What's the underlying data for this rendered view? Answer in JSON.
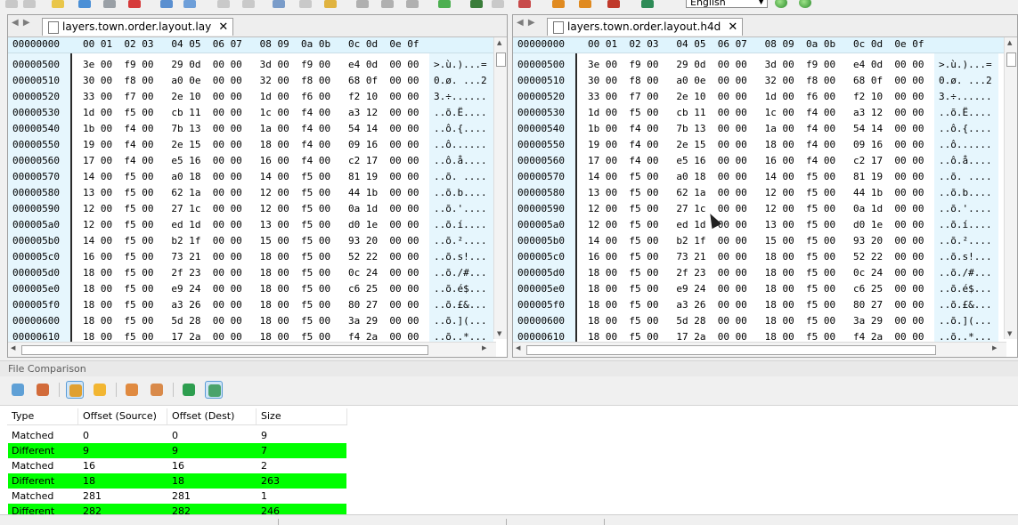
{
  "toolbar": {
    "language": "English"
  },
  "colors": {
    "offset_bg": "#e6f6fd",
    "diff_row": "#00ff00",
    "selected": "#cfe5f7"
  },
  "hex_header": {
    "offset_label": "00000000",
    "cols": "00 01  02 03   04 05  06 07   08 09  0a 0b   0c 0d  0e 0f"
  },
  "left_pane": {
    "tab_title": "layers.town.order.layout.lay",
    "rows": [
      {
        "offset": "00000500",
        "hex": "3e 00  f9 00   29 0d  00 00   3d 00  f9 00   e4 0d  00 00",
        "ascii": ">.ù.)...="
      },
      {
        "offset": "00000510",
        "hex": "30 00  f8 00   a0 0e  00 00   32 00  f8 00   68 0f  00 00",
        "ascii": "0.ø. ...2"
      },
      {
        "offset": "00000520",
        "hex": "33 00  f7 00   2e 10  00 00   1d 00  f6 00   f2 10  00 00",
        "ascii": "3.÷......"
      },
      {
        "offset": "00000530",
        "hex": "1d 00  f5 00   cb 11  00 00   1c 00  f4 00   a3 12  00 00",
        "ascii": "..õ.Ë...."
      },
      {
        "offset": "00000540",
        "hex": "1b 00  f4 00   7b 13  00 00   1a 00  f4 00   54 14  00 00",
        "ascii": "..ô.{...."
      },
      {
        "offset": "00000550",
        "hex": "19 00  f4 00   2e 15  00 00   18 00  f4 00   09 16  00 00",
        "ascii": "..ô......"
      },
      {
        "offset": "00000560",
        "hex": "17 00  f4 00   e5 16  00 00   16 00  f4 00   c2 17  00 00",
        "ascii": "..ô.å...."
      },
      {
        "offset": "00000570",
        "hex": "14 00  f5 00   a0 18  00 00   14 00  f5 00   81 19  00 00",
        "ascii": "..õ. ...."
      },
      {
        "offset": "00000580",
        "hex": "13 00  f5 00   62 1a  00 00   12 00  f5 00   44 1b  00 00",
        "ascii": "..õ.b...."
      },
      {
        "offset": "00000590",
        "hex": "12 00  f5 00   27 1c  00 00   12 00  f5 00   0a 1d  00 00",
        "ascii": "..õ.'...."
      },
      {
        "offset": "000005a0",
        "hex": "12 00  f5 00   ed 1d  00 00   13 00  f5 00   d0 1e  00 00",
        "ascii": "..õ.í...."
      },
      {
        "offset": "000005b0",
        "hex": "14 00  f5 00   b2 1f  00 00   15 00  f5 00   93 20  00 00",
        "ascii": "..õ.².... "
      },
      {
        "offset": "000005c0",
        "hex": "16 00  f5 00   73 21  00 00   18 00  f5 00   52 22  00 00",
        "ascii": "..õ.s!..."
      },
      {
        "offset": "000005d0",
        "hex": "18 00  f5 00   2f 23  00 00   18 00  f5 00   0c 24  00 00",
        "ascii": "..õ./#..."
      },
      {
        "offset": "000005e0",
        "hex": "18 00  f5 00   e9 24  00 00   18 00  f5 00   c6 25  00 00",
        "ascii": "..õ.é$..."
      },
      {
        "offset": "000005f0",
        "hex": "18 00  f5 00   a3 26  00 00   18 00  f5 00   80 27  00 00",
        "ascii": "..õ.£&..."
      },
      {
        "offset": "00000600",
        "hex": "18 00  f5 00   5d 28  00 00   18 00  f5 00   3a 29  00 00",
        "ascii": "..õ.](..."
      },
      {
        "offset": "00000610",
        "hex": "18 00  f5 00   17 2a  00 00   18 00  f5 00   f4 2a  00 00",
        "ascii": "..õ..*..."
      }
    ]
  },
  "right_pane": {
    "tab_title": "layers.town.order.layout.h4d",
    "rows": [
      {
        "offset": "00000500",
        "hex": "3e 00  f9 00   29 0d  00 00   3d 00  f9 00   e4 0d  00 00",
        "ascii": ">.ù.)...="
      },
      {
        "offset": "00000510",
        "hex": "30 00  f8 00   a0 0e  00 00   32 00  f8 00   68 0f  00 00",
        "ascii": "0.ø. ...2"
      },
      {
        "offset": "00000520",
        "hex": "33 00  f7 00   2e 10  00 00   1d 00  f6 00   f2 10  00 00",
        "ascii": "3.÷......"
      },
      {
        "offset": "00000530",
        "hex": "1d 00  f5 00   cb 11  00 00   1c 00  f4 00   a3 12  00 00",
        "ascii": "..õ.Ë...."
      },
      {
        "offset": "00000540",
        "hex": "1b 00  f4 00   7b 13  00 00   1a 00  f4 00   54 14  00 00",
        "ascii": "..ô.{...."
      },
      {
        "offset": "00000550",
        "hex": "19 00  f4 00   2e 15  00 00   18 00  f4 00   09 16  00 00",
        "ascii": "..ô......"
      },
      {
        "offset": "00000560",
        "hex": "17 00  f4 00   e5 16  00 00   16 00  f4 00   c2 17  00 00",
        "ascii": "..ô.å...."
      },
      {
        "offset": "00000570",
        "hex": "14 00  f5 00   a0 18  00 00   14 00  f5 00   81 19  00 00",
        "ascii": "..õ. ...."
      },
      {
        "offset": "00000580",
        "hex": "13 00  f5 00   62 1a  00 00   12 00  f5 00   44 1b  00 00",
        "ascii": "..õ.b...."
      },
      {
        "offset": "00000590",
        "hex": "12 00  f5 00   27 1c  00 00   12 00  f5 00   0a 1d  00 00",
        "ascii": "..õ.'...."
      },
      {
        "offset": "000005a0",
        "hex": "12 00  f5 00   ed 1d  00 00   13 00  f5 00   d0 1e  00 00",
        "ascii": "..õ.í...."
      },
      {
        "offset": "000005b0",
        "hex": "14 00  f5 00   b2 1f  00 00   15 00  f5 00   93 20  00 00",
        "ascii": "..õ.².... "
      },
      {
        "offset": "000005c0",
        "hex": "16 00  f5 00   73 21  00 00   18 00  f5 00   52 22  00 00",
        "ascii": "..õ.s!..."
      },
      {
        "offset": "000005d0",
        "hex": "18 00  f5 00   2f 23  00 00   18 00  f5 00   0c 24  00 00",
        "ascii": "..õ./#..."
      },
      {
        "offset": "000005e0",
        "hex": "18 00  f5 00   e9 24  00 00   18 00  f5 00   c6 25  00 00",
        "ascii": "..õ.é$..."
      },
      {
        "offset": "000005f0",
        "hex": "18 00  f5 00   a3 26  00 00   18 00  f5 00   80 27  00 00",
        "ascii": "..õ.£&..."
      },
      {
        "offset": "00000600",
        "hex": "18 00  f5 00   5d 28  00 00   18 00  f5 00   3a 29  00 00",
        "ascii": "..õ.](..."
      },
      {
        "offset": "00000610",
        "hex": "18 00  f5 00   17 2a  00 00   18 00  f5 00   f4 2a  00 00",
        "ascii": "..õ..*..."
      }
    ]
  },
  "comparison": {
    "title": "File Comparison",
    "columns": [
      "Type",
      "Offset (Source)",
      "Offset (Dest)",
      "Size"
    ],
    "rows": [
      {
        "type": "Matched",
        "src": "0",
        "dst": "0",
        "size": "9",
        "diff": false
      },
      {
        "type": "Different",
        "src": "9",
        "dst": "9",
        "size": "7",
        "diff": true
      },
      {
        "type": "Matched",
        "src": "16",
        "dst": "16",
        "size": "2",
        "diff": false
      },
      {
        "type": "Different",
        "src": "18",
        "dst": "18",
        "size": "263",
        "diff": true
      },
      {
        "type": "Matched",
        "src": "281",
        "dst": "281",
        "size": "1",
        "diff": false
      },
      {
        "type": "Different",
        "src": "282",
        "dst": "282",
        "size": "246",
        "diff": true
      }
    ]
  }
}
